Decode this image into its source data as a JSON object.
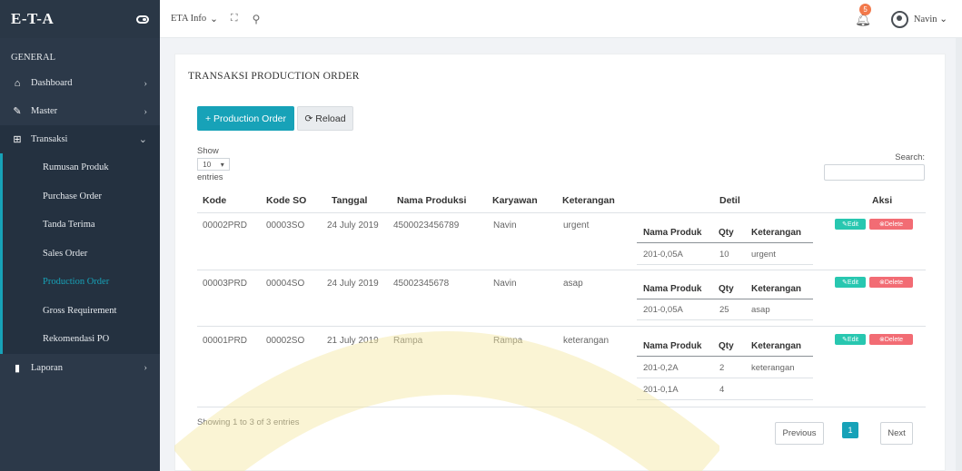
{
  "brand": "E-T-A",
  "sidebar": {
    "section": "GENERAL",
    "items": [
      {
        "label": "Dashboard",
        "icon": "home-icon"
      },
      {
        "label": "Master",
        "icon": "edit-icon"
      },
      {
        "label": "Transaksi",
        "icon": "grid-icon"
      },
      {
        "label": "Laporan",
        "icon": "bar-chart-icon"
      }
    ],
    "sub_items": [
      "Rumusan Produk",
      "Purchase Order",
      "Tanda Terima",
      "Sales Order",
      "Production Order",
      "Gross Requirement",
      "Rekomendasi PO"
    ],
    "active_sub": "Production Order"
  },
  "topbar": {
    "menu_label": "ETA Info",
    "notification_count": "5",
    "user_name": "Navin"
  },
  "page": {
    "title": "TRANSAKSI PRODUCTION ORDER",
    "add_button": "+ Production Order",
    "reload_button": "Reload",
    "show_label": "Show",
    "show_value": "10",
    "entries_label": "entries",
    "search_label": "Search:",
    "footer_info": "Showing 1 to 3 of 3 entries",
    "prev_label": "Previous",
    "next_label": "Next",
    "current_page": "1"
  },
  "table": {
    "headers": [
      "Kode",
      "Kode SO",
      "Tanggal",
      "Nama Produksi",
      "Karyawan",
      "Keterangan",
      "Detil",
      "Aksi"
    ],
    "detail_headers": [
      "Nama Produk",
      "Qty",
      "Keterangan"
    ],
    "edit_label": "Edit",
    "delete_label": "Delete",
    "rows": [
      {
        "kode": "00002PRD",
        "kode_so": "00003SO",
        "tanggal": "24 July 2019",
        "nama_produksi": "4500023456789",
        "karyawan": "Navin",
        "keterangan": "urgent",
        "detail": [
          {
            "nama": "201-0,05A",
            "qty": "10",
            "ket": "urgent"
          }
        ]
      },
      {
        "kode": "00003PRD",
        "kode_so": "00004SO",
        "tanggal": "24 July 2019",
        "nama_produksi": "45002345678",
        "karyawan": "Navin",
        "keterangan": "asap",
        "detail": [
          {
            "nama": "201-0,05A",
            "qty": "25",
            "ket": "asap"
          }
        ]
      },
      {
        "kode": "00001PRD",
        "kode_so": "00002SO",
        "tanggal": "21 July 2019",
        "nama_produksi": "Rampa",
        "karyawan": "Rampa",
        "keterangan": "keterangan",
        "detail": [
          {
            "nama": "201-0,2A",
            "qty": "2",
            "ket": "keterangan"
          },
          {
            "nama": "201-0,1A",
            "qty": "4",
            "ket": ""
          }
        ]
      }
    ]
  },
  "colors": {
    "accent": "#17a2b8",
    "sidebar": "#2c3949",
    "edit": "#28c7b0",
    "delete": "#f26c74",
    "badge": "#f2794b"
  }
}
